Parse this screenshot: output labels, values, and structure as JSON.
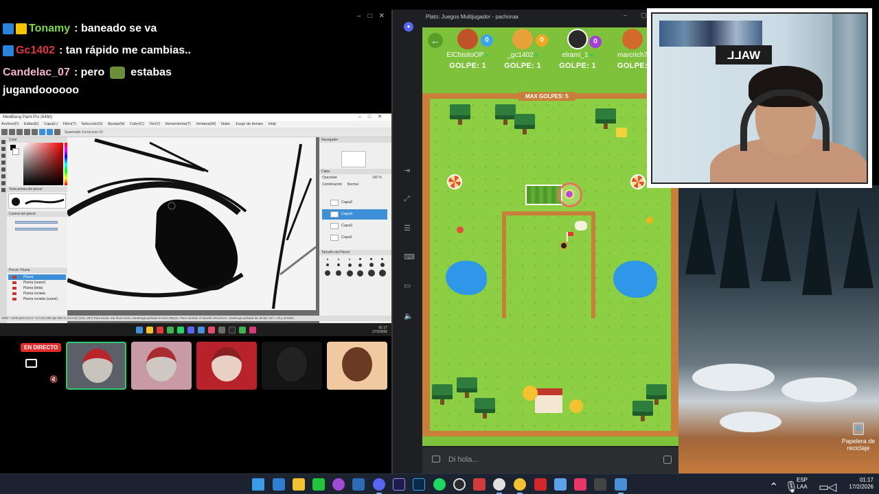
{
  "chat": {
    "messages": [
      {
        "user": "Tonamy",
        "sep": ":",
        "text": "baneado se va",
        "color": "#7fd94a"
      },
      {
        "user": "Gc1402",
        "sep": ":",
        "text": "tan rápido me cambias..",
        "color": "#e0393e"
      },
      {
        "user": "Candelac_07",
        "sep": ":",
        "text_a": "pero",
        "text_b": "estabas",
        "text_c": "jugandoooooo",
        "color": "#f2b6c9"
      }
    ]
  },
  "paint": {
    "title": "MediBang Paint Pro (64bit)",
    "menu": [
      "Archivo(F)",
      "Editar(E)",
      "Capa(L)",
      "Filtro(T)",
      "Selección(S)",
      "Ajustar(N)",
      "Color(C)",
      "Ver(V)",
      "Herramienta(T)",
      "Ventana(W)",
      "Nube",
      "Juego de tiempo",
      "Help"
    ],
    "toolbar_text": "Suavizado   Corrección   15",
    "panels": {
      "color": "Color",
      "brush_preview": "Vista previa del pincel",
      "brush_control": "Control del pincel",
      "brush_list": "Pincel: Pluma",
      "navigator": "Navegador",
      "layer": "Capa",
      "brush_size": "Tamaño del Pincel"
    },
    "brushes": [
      "Pluma",
      "Pluma (suave)",
      "Pluma (tinta)",
      "Pluma rociada",
      "Pluma rociada (suave)"
    ],
    "layers": [
      {
        "name": "Capa2",
        "selected": false
      },
      {
        "name": "Capa4",
        "selected": true
      },
      {
        "name": "Capa3",
        "selected": false
      },
      {
        "name": "Capa1",
        "selected": false
      }
    ],
    "layer_opacity_label": "Opacidad",
    "layer_opacity_value": "100 %",
    "blend_label": "Combinación",
    "blend_value": "Normal",
    "status": "4800 * 1200 pixel (11.6 * 8.7cm) 350 dpi 400 % (XxYxZ) (224, 587) Para trazar una línea recta, mantenga pulsada la tecla Mayús. Para cambiar el tamaño del pincel, mantenga pulsada las teclas Ctrl + Alt y arrastre",
    "inner_clock_time": "01:17",
    "inner_clock_date": "17/2/2026"
  },
  "stream": {
    "live_label": "EN DIRECTO"
  },
  "activity": {
    "window_title": "Plato: Juegos Multijugador - pachoraa",
    "max_strokes": "MAX GOLPES: 5",
    "players": [
      {
        "name": "ElChisitoOP",
        "count": "0",
        "hits": "GOLPE: 1",
        "color": "#c0522a",
        "badge": "#3aa5e8"
      },
      {
        "name": "_gc1402",
        "count": "0",
        "hits": "GOLPE: 1",
        "color": "#e8a23a",
        "badge": "#f5a623"
      },
      {
        "name": "elrami_1",
        "count": "0",
        "hits": "GOLPE: 1",
        "color": "#2a2a2a",
        "badge": "#a340d9"
      },
      {
        "name": "marcrich7",
        "count": "",
        "hits": "GOLPE:",
        "color": "#d16a2a",
        "badge": "#3aa5e8"
      }
    ],
    "chat_placeholder": "Di hola..."
  },
  "webcam": {
    "sign_text": "WALL"
  },
  "desktop": {
    "recycle_label": "Papelera de reciclaje"
  },
  "taskbar": {
    "lang_1": "ESP",
    "lang_2": "LAA",
    "time": "01:17",
    "date": "17/2/2026"
  }
}
